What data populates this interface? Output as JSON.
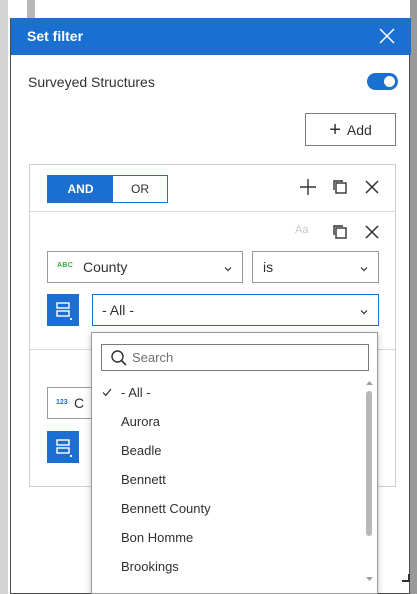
{
  "dialog": {
    "title": "Set filter",
    "layer_label": "Surveyed Structures",
    "toggle_on": true,
    "add_label": "Add"
  },
  "group": {
    "and_label": "AND",
    "or_label": "OR",
    "mode": "AND"
  },
  "clause1": {
    "case_label": "Aa",
    "field_type": "ABC",
    "field": "County",
    "operator": "is",
    "value": "- All -"
  },
  "clause2": {
    "field_type": "123",
    "field_partial": "C"
  },
  "dropdown": {
    "search_placeholder": "Search",
    "options": [
      {
        "label": "- All -",
        "selected": true
      },
      {
        "label": "Aurora",
        "selected": false
      },
      {
        "label": "Beadle",
        "selected": false
      },
      {
        "label": "Bennett",
        "selected": false
      },
      {
        "label": "Bennett County",
        "selected": false
      },
      {
        "label": "Bon Homme",
        "selected": false
      },
      {
        "label": "Brookings",
        "selected": false
      },
      {
        "label": "-",
        "selected": false
      }
    ]
  },
  "colors": {
    "accent": "#1a6fd1",
    "text": "#303030",
    "string_type": "#35ac46"
  }
}
